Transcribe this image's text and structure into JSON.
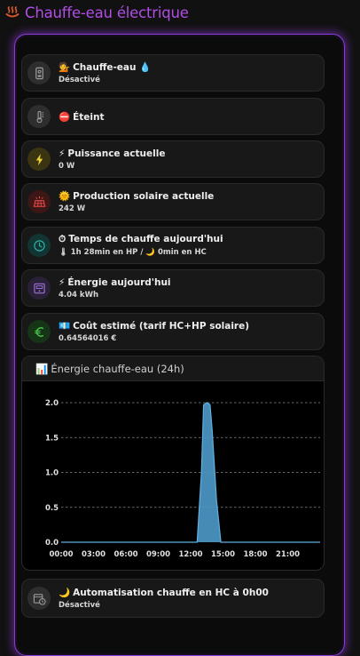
{
  "header": {
    "title": "Chauffe-eau électrique",
    "icon": "heat-waves-icon"
  },
  "tiles": [
    {
      "icon": "water-heater-icon",
      "icon_color": "#9a9a9a",
      "icon_bg": "#2e2e2e",
      "title_emoji": "💁",
      "title": "Chauffe-eau 💧",
      "subtitle": "Désactivé"
    },
    {
      "icon": "thermometer-icon",
      "icon_color": "#9a9a9a",
      "icon_bg": "#2e2e2e",
      "title_emoji": "⛔",
      "title": "Éteint",
      "subtitle": ""
    },
    {
      "icon": "flash-icon",
      "icon_color": "#e8d034",
      "icon_bg": "#3a3412",
      "title_emoji": "⚡",
      "title": "Puissance actuelle",
      "subtitle": "0 W"
    },
    {
      "icon": "solar-panel-icon",
      "icon_color": "#e84848",
      "icon_bg": "#3d1616",
      "title_emoji": "🌞",
      "title": "Production solaire actuelle",
      "subtitle": "242 W"
    },
    {
      "icon": "clock-icon",
      "icon_color": "#2ab0a4",
      "icon_bg": "#123432",
      "title_emoji": "⏱",
      "title": "Temps de chauffe aujourd'hui",
      "subtitle": "🌡 1h 28min en HP / 🌙 0min en HC"
    },
    {
      "icon": "meter-icon",
      "icon_color": "#a070d8",
      "icon_bg": "#2a2038",
      "title_emoji": "⚡",
      "title": "Énergie aujourd'hui",
      "subtitle": "4.04 kWh"
    },
    {
      "icon": "euro-icon",
      "icon_color": "#48c048",
      "icon_bg": "#163416",
      "title_emoji": "💶",
      "title": "Coût estimé (tarif HC+HP solaire)",
      "subtitle": "0.64564016 €"
    },
    {
      "icon": "calendar-clock-icon",
      "icon_color": "#9a9a9a",
      "icon_bg": "#2e2e2e",
      "title_emoji": "🌙",
      "title": "Automatisation chauffe en HC à 0h00",
      "subtitle": "Désactivé"
    }
  ],
  "chart_card": {
    "emoji": "📊",
    "title": "Énergie chauffe-eau (24h)"
  },
  "colors": {
    "accent": "#b04ee6",
    "series_fill": "#4d9ac9",
    "series_line": "#5fb0e0"
  },
  "chart_data": {
    "type": "area",
    "title": "Énergie chauffe-eau (24h)",
    "xlabel": "",
    "ylabel": "",
    "xlim": [
      0,
      24
    ],
    "ylim": [
      0,
      2.0
    ],
    "xticks": [
      "00:00",
      "03:00",
      "06:00",
      "09:00",
      "12:00",
      "15:00",
      "18:00",
      "21:00"
    ],
    "yticks": [
      "0.0",
      "0.5",
      "1.0",
      "1.5",
      "2.0"
    ],
    "grid": true,
    "series": [
      {
        "name": "",
        "x": [
          0,
          12.0,
          12.6,
          13.0,
          13.2,
          13.5,
          13.8,
          14.0,
          14.4,
          14.8,
          15.2,
          24
        ],
        "values": [
          0,
          0,
          0,
          1.0,
          1.97,
          2.0,
          1.97,
          1.6,
          0.6,
          0,
          0,
          0
        ]
      }
    ]
  }
}
